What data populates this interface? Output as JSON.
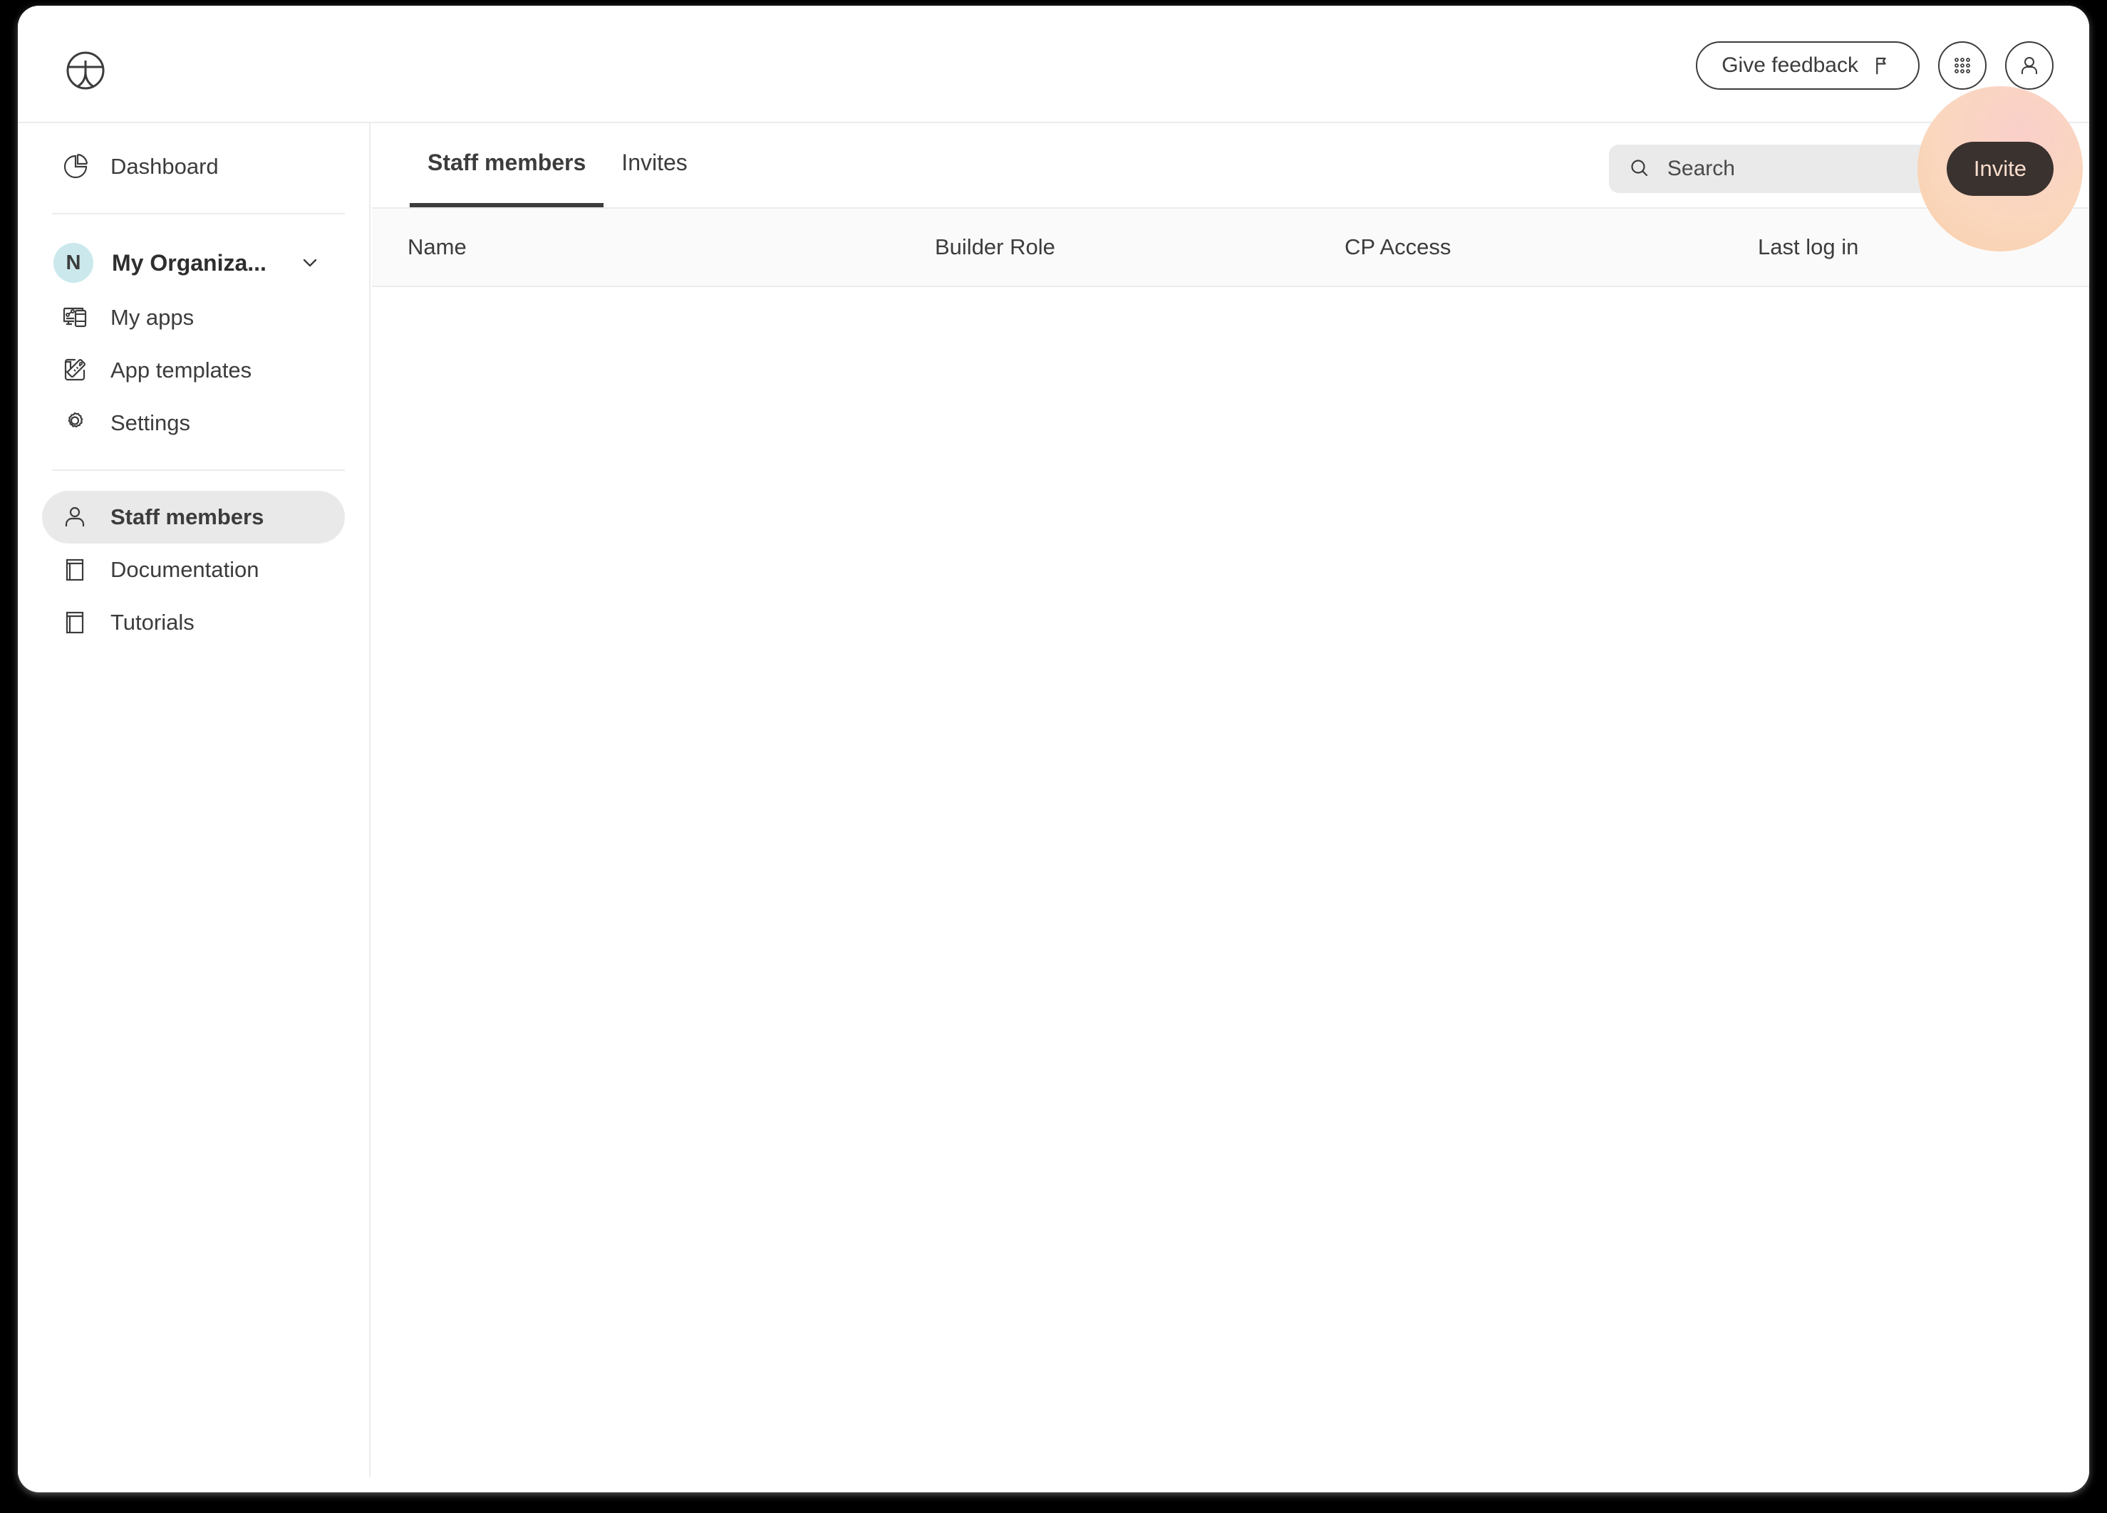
{
  "brand": {
    "logo_icon": "betty-blocks-logo-icon"
  },
  "topbar": {
    "feedback_label": "Give feedback",
    "feedback_icon": "flag-icon",
    "apps_grid_icon": "apps-grid-icon",
    "account_icon": "user-avatar-icon"
  },
  "sidebar": {
    "top_items": [
      {
        "label": "Dashboard",
        "icon": "pie-chart-icon"
      }
    ],
    "org": {
      "initial": "N",
      "name": "My Organiza...",
      "chevron_icon": "chevron-down-icon",
      "avatar_color": "#cbe9ec"
    },
    "middle_items": [
      {
        "label": "My apps",
        "icon": "devices-icon"
      },
      {
        "label": "App templates",
        "icon": "template-ruler-icon"
      },
      {
        "label": "Settings",
        "icon": "gear-icon"
      }
    ],
    "bottom_items": [
      {
        "label": "Staff members",
        "icon": "person-icon",
        "active": true
      },
      {
        "label": "Documentation",
        "icon": "book-icon",
        "active": false
      },
      {
        "label": "Tutorials",
        "icon": "book-icon",
        "active": false
      }
    ]
  },
  "main": {
    "tabs": [
      {
        "label": "Staff members",
        "active": true
      },
      {
        "label": "Invites",
        "active": false
      }
    ],
    "search": {
      "value": "",
      "placeholder": "Search",
      "icon": "search-icon"
    },
    "invite_button": {
      "label": "Invite",
      "bg_color": "#3a322f",
      "text_color": "#f9ddcd",
      "highlight_color": "#fad5ba"
    },
    "table": {
      "columns": [
        "Name",
        "Builder Role",
        "CP Access",
        "Last log in"
      ],
      "rows": []
    }
  }
}
